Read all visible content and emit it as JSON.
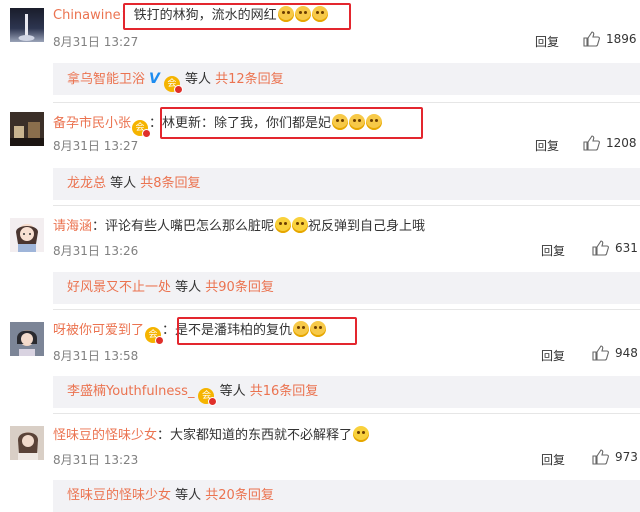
{
  "comments": [
    {
      "user": "Chinawine",
      "verified_badge": false,
      "colon": "：",
      "text": "铁打的林狗，流水的网红",
      "emoji_count": 3,
      "time": "8月31日 13:27",
      "reply_label": "回复",
      "likes": "1896",
      "sub": {
        "user": "拿乌智能卫浴",
        "verified_v": true,
        "badge": true,
        "mid": " 等人 ",
        "count": "共12条回复"
      }
    },
    {
      "user": "备孕市民小张",
      "verified_badge": true,
      "colon": "：",
      "text": "林更新：除了我，你们都是妃",
      "emoji_count": 3,
      "time": "8月31日 13:27",
      "reply_label": "回复",
      "likes": "1208",
      "sub": {
        "user": "龙龙总",
        "verified_v": false,
        "badge": false,
        "mid": " 等人 ",
        "count": "共8条回复"
      }
    },
    {
      "user": "请海涵",
      "verified_badge": false,
      "colon": "：",
      "text": "评论有些人嘴巴怎么那么脏呢",
      "text_after": "祝反弹到自己身上哦",
      "emoji_count": 2,
      "time": "8月31日 13:26",
      "reply_label": "回复",
      "likes": "631",
      "sub": {
        "user": "好风景又不止一处",
        "verified_v": false,
        "badge": false,
        "mid": " 等人 ",
        "count": "共90条回复"
      }
    },
    {
      "user": "呀被你可爱到了",
      "verified_badge": true,
      "colon": "：",
      "text": "是不是潘玮柏的复仇",
      "emoji_count": 2,
      "time": "8月31日 13:58",
      "reply_label": "回复",
      "likes": "948",
      "sub": {
        "user": "李盛楠Youthfulness_",
        "verified_v": false,
        "badge": true,
        "mid": " 等人 ",
        "count": "共16条回复"
      }
    },
    {
      "user": "怪味豆的怪味少女",
      "verified_badge": false,
      "colon": "：",
      "text": "大家都知道的东西就不必解释了",
      "emoji_count": 1,
      "time": "8月31日 13:23",
      "reply_label": "回复",
      "likes": "973",
      "sub": {
        "user": "怪味豆的怪味少女",
        "verified_v": false,
        "badge": false,
        "mid": " 等人 ",
        "count": "共20条回复"
      }
    }
  ],
  "colors": {
    "username": "#eb7350",
    "highlight_box": "#e3262e",
    "sub_bg": "#f2f2f5",
    "v_blue": "#1d8cf0"
  },
  "icons": {
    "like": "thumbs-up-icon",
    "emoji": "doge-emoji-icon",
    "badge": "vip-badge-icon"
  }
}
